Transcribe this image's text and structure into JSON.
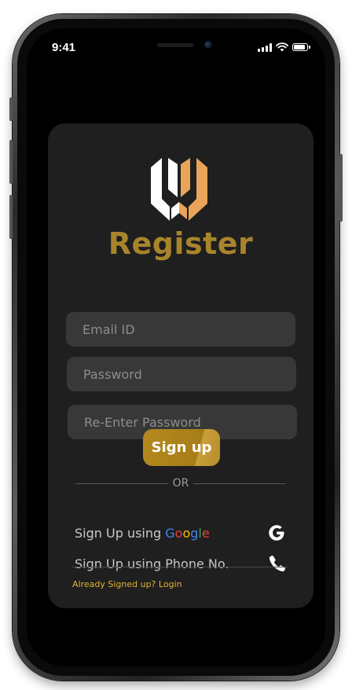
{
  "status_bar": {
    "time": "9:41",
    "battery_level": 0.9
  },
  "app": {
    "logo_icon": "uv-logo-icon",
    "title": "Register",
    "title_color": "#a8842c"
  },
  "form": {
    "email_placeholder": "Email ID",
    "password_placeholder": "Password",
    "reenter_password_placeholder": "Re-Enter Password",
    "signup_label": "Sign up",
    "button_color": "#b58a1f"
  },
  "alternatives": {
    "or_label": "OR",
    "google_prefix": "Sign Up using ",
    "google_letters": [
      "G",
      "o",
      "o",
      "g",
      "l",
      "e"
    ],
    "google_colors": [
      "#4285F4",
      "#EA4335",
      "#FBBC05",
      "#4285F4",
      "#34A853",
      "#EA4335"
    ],
    "google_icon": "google-g-icon",
    "phone_label": "Sign Up using Phone No.",
    "phone_icon": "phone-icon"
  },
  "footer": {
    "login_link": "Already Signed up? Login",
    "link_color": "#e0b431"
  }
}
